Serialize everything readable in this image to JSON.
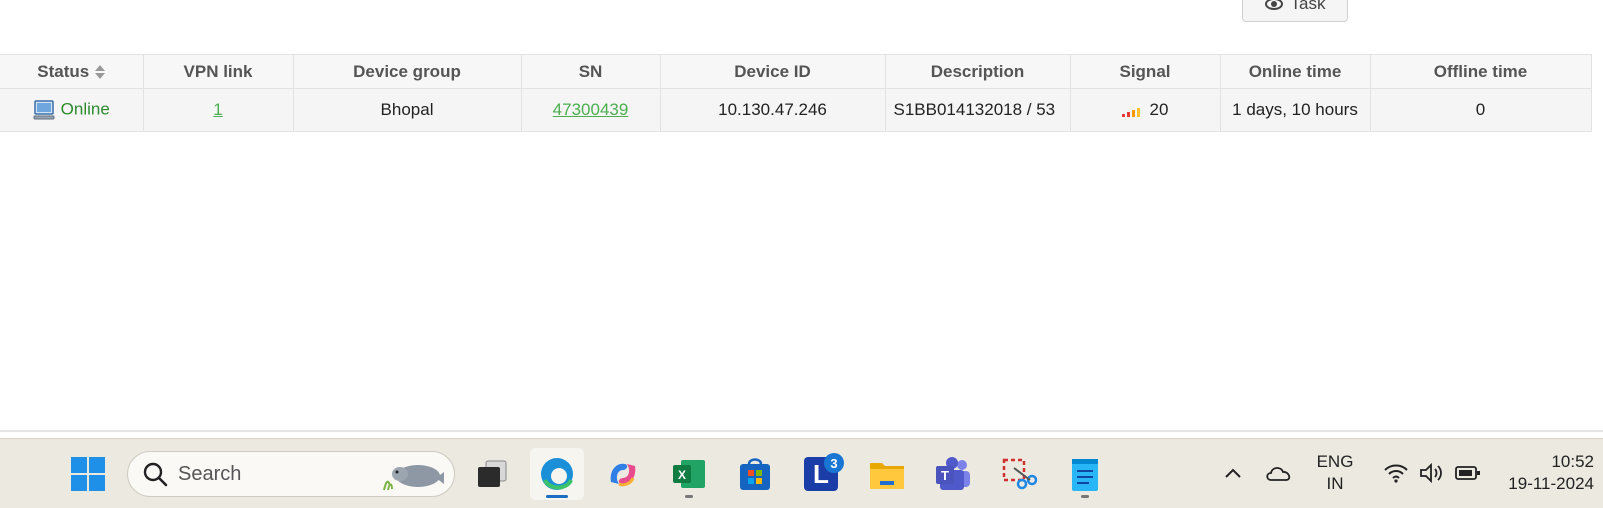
{
  "task_button": {
    "label": "Task"
  },
  "table": {
    "headers": [
      "Status",
      "VPN link",
      "Device group",
      "SN",
      "Device ID",
      "Description",
      "Signal",
      "Online time",
      "Offline time"
    ],
    "rows": [
      {
        "status": "Online",
        "vpn_link": "1",
        "device_group": "Bhopal",
        "sn": "47300439",
        "device_id": "10.130.47.246",
        "description": "S1BB014132018 / 53",
        "signal": "20",
        "online_time": "1 days, 10 hours",
        "offline_time": "0"
      }
    ]
  },
  "taskbar": {
    "search_placeholder": "Search",
    "apps": [
      {
        "name": "Task view"
      },
      {
        "name": "Microsoft Edge"
      },
      {
        "name": "Copilot"
      },
      {
        "name": "Excel"
      },
      {
        "name": "Microsoft Store"
      },
      {
        "name": "L app",
        "badge": "3"
      },
      {
        "name": "File Explorer"
      },
      {
        "name": "Teams"
      },
      {
        "name": "Snipping Tool"
      },
      {
        "name": "Notepad"
      }
    ],
    "language_line1": "ENG",
    "language_line2": "IN",
    "time": "10:52",
    "date": "19-11-2024"
  },
  "colors": {
    "online": "#2e8b2e",
    "link": "#4caf50",
    "signal_bars": "#e53935",
    "taskbar_bg": "#ece9e0"
  }
}
